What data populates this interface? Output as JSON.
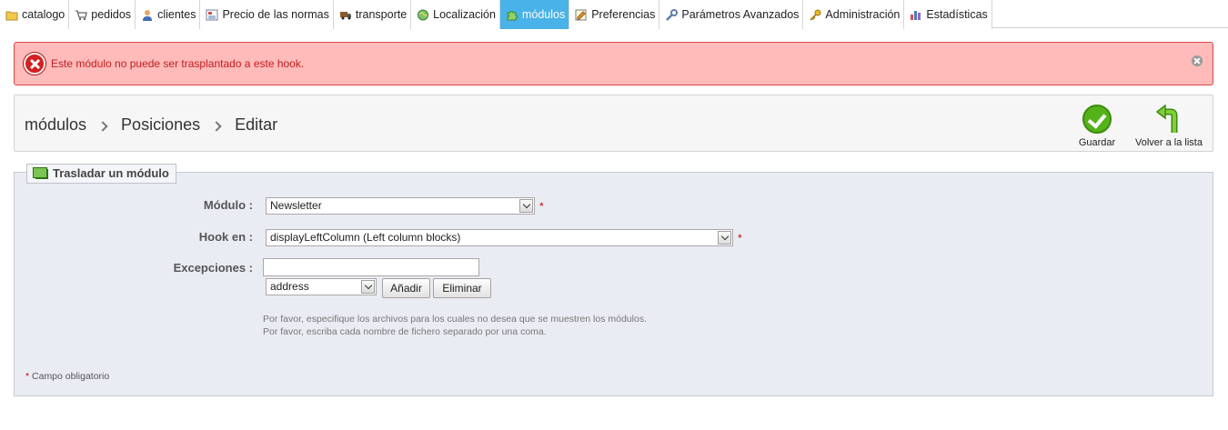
{
  "nav": {
    "tabs": [
      {
        "label": "catalogo",
        "icon": "folder-icon"
      },
      {
        "label": "pedidos",
        "icon": "cart-icon"
      },
      {
        "label": "clientes",
        "icon": "user-icon"
      },
      {
        "label": "Precio de las normas",
        "icon": "price-rules-icon"
      },
      {
        "label": "transporte",
        "icon": "truck-icon"
      },
      {
        "label": "Localización",
        "icon": "globe-icon"
      },
      {
        "label": "módulos",
        "icon": "puzzle-icon"
      },
      {
        "label": "Preferencias",
        "icon": "preferences-icon"
      },
      {
        "label": "Parámetros Avanzados",
        "icon": "wrench-icon"
      },
      {
        "label": "Administración",
        "icon": "key-icon"
      },
      {
        "label": "Estadísticas",
        "icon": "bar-chart-icon"
      }
    ],
    "active_tab": "módulos",
    "active_color": "#49b2e8"
  },
  "error": {
    "message": "Este módulo no puede ser trasplantado a este hook.",
    "icon": "error-x-icon",
    "close_icon": "close-icon"
  },
  "toolbar": {
    "breadcrumb": [
      "módulos",
      "Posiciones",
      "Editar"
    ],
    "save_label": "Guardar",
    "back_label": "Volver a la lista"
  },
  "form": {
    "legend": "Trasladar un módulo",
    "module_label": "Módulo :",
    "module_value": "Newsletter",
    "hook_label": "Hook en :",
    "hook_value": "displayLeftColumn (Left column blocks)",
    "exceptions_label": "Excepciones :",
    "exceptions_value": "",
    "exceptions_select_value": "address",
    "add_label": "Añadir",
    "remove_label": "Eliminar",
    "hint_line1": "Por favor, especifique los archivos para los cuales no desea que se muestren los módulos.",
    "hint_line2": "Por favor, escriba cada nombre de fichero separado por una coma.",
    "required_star": "*",
    "required_note": "Campo obligatorio"
  }
}
